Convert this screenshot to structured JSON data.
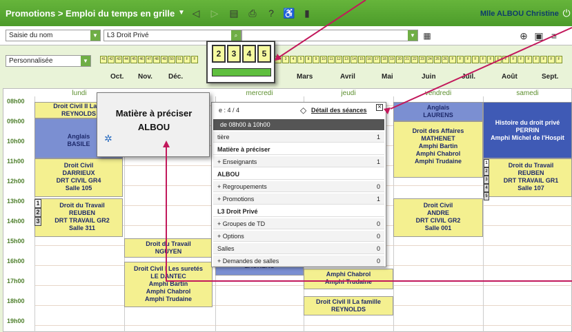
{
  "title": "Promotions > Emploi du temps en grille",
  "user": "Mlle ALBOU Christine",
  "toolbar": {
    "mode": "Saisie du nom",
    "promo": "L3 Droit Privé",
    "period": "Personnalisée"
  },
  "weeks": [
    "41",
    "42",
    "43",
    "44",
    "45",
    "46",
    "47",
    "48",
    "49",
    "50",
    "51",
    "F",
    "F",
    "2",
    "3",
    "4",
    "5",
    "8",
    "9",
    "10",
    "11",
    "12",
    "13",
    "14",
    "15",
    "16",
    "17",
    "18",
    "19",
    "20",
    "21",
    "22",
    "23",
    "24",
    "25",
    "26",
    "F",
    "F",
    "F",
    "F",
    "F",
    "F",
    "F",
    "F",
    "F",
    "F",
    "F",
    "F",
    "F",
    "F",
    "F"
  ],
  "months": [
    "Oct.",
    "Nov.",
    "Déc.",
    "Mars",
    "Avril",
    "Mai",
    "Juin",
    "Juil.",
    "Août",
    "Sept."
  ],
  "zoom_weeks": [
    "2",
    "3",
    "4",
    "5"
  ],
  "days": [
    "lundi",
    "mercredi",
    "jeudi",
    "vendredi",
    "samedi"
  ],
  "hours": [
    "08h00",
    "09h00",
    "10h00",
    "11h00",
    "12h00",
    "13h00",
    "14h00",
    "15h00",
    "16h00",
    "17h00",
    "18h00",
    "19h00"
  ],
  "courses": {
    "c1": "Droit Civil II La fa",
    "c1b": "REYNOLDS",
    "c2": "Anglais",
    "c2b": "BASILE",
    "c3": "Droit Civil",
    "c3b": "DARRIEUX",
    "c3c": "DRT CIVIL GR4",
    "c3d": "Salle 105",
    "c4": "Droit du Travail",
    "c4b": "REUBEN",
    "c4c": "DRT TRAVAIL GR2",
    "c4d": "Salle 311",
    "c4n1": "1",
    "c4n2": "2",
    "c4n3": "3",
    "c5": "Droit du Travail",
    "c5b": "NGUYEN",
    "c6": "Droit Civil I Les suretés",
    "c6b": "LE DANTEC",
    "c6c": "Amphi Bartin",
    "c6d": "Amphi Chabrol",
    "c6e": "Amphi Trudaine",
    "c7": "LAURENS",
    "c8": "Amphi Chabrol",
    "c8b": "Amphi Trudaine",
    "c9": "Droit Civil II La famille",
    "c9b": "REYNOLDS",
    "c10": "Anglais",
    "c10b": "LAURENS",
    "c11": "Droit des Affaires",
    "c11b": "MATHENET",
    "c11c": "Amphi Bartin",
    "c11d": "Amphi Chabrol",
    "c11e": "Amphi Trudaine",
    "c12": "Droit Civil",
    "c12b": "ANDRE",
    "c12c": "DRT CIVIL GR2",
    "c12d": "Salle 001",
    "c13": "Histoire du droit privé",
    "c13b": "PERRIN",
    "c13c": "Amphi Michel de l'Hospit",
    "c14": "Droit du Travail",
    "c14b": "REUBEN",
    "c14c": "DRT TRAVAIL GR1",
    "c14d": "Salle 107",
    "c14n1": "1",
    "c14n2": "2",
    "c14n3": "3",
    "c14n4": "4",
    "c14n5": "5"
  },
  "popup": {
    "count": "e : 4 / 4",
    "detail": "Détail des séances",
    "time": "de 08h00 à 10h00",
    "rows": [
      {
        "label": "tière",
        "value": "1"
      },
      {
        "label": "Matière à préciser",
        "value": ""
      },
      {
        "label": "+ Enseignants",
        "value": "1"
      },
      {
        "label": "ALBOU",
        "value": ""
      },
      {
        "label": "+ Regroupements",
        "value": "0"
      },
      {
        "label": "+ Promotions",
        "value": "1"
      },
      {
        "label": "L3 Droit Privé",
        "value": ""
      },
      {
        "label": "+ Groupes de TD",
        "value": "0"
      },
      {
        "label": "+ Options",
        "value": "0"
      },
      {
        "label": "Salles",
        "value": "0"
      },
      {
        "label": "+ Demandes de salles",
        "value": "0"
      }
    ]
  },
  "tooltip": {
    "line1": "Matière à préciser",
    "line2": "ALBOU"
  }
}
